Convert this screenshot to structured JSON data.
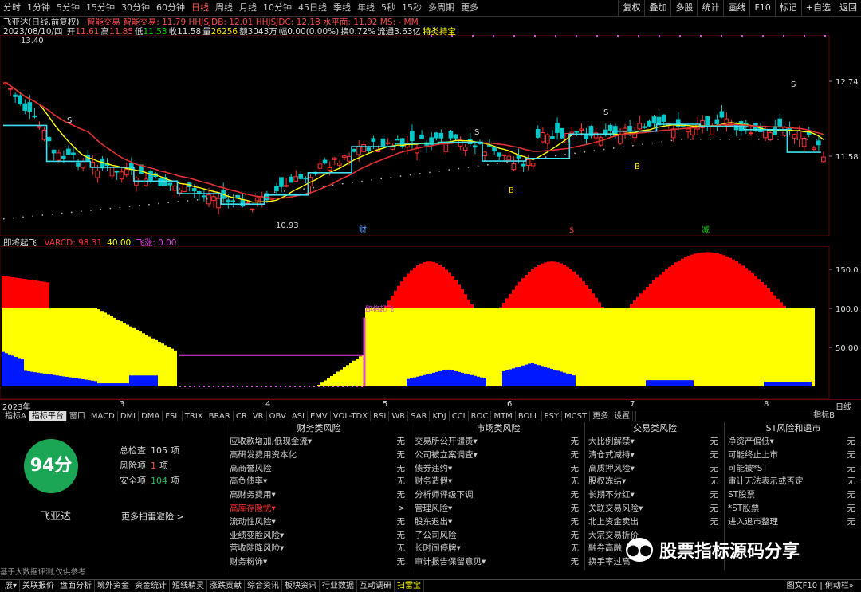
{
  "window": {
    "timeframes": [
      "分时",
      "1分钟",
      "5分钟",
      "15分钟",
      "30分钟",
      "60分钟",
      "日线",
      "周线",
      "月线",
      "10分钟",
      "45日线",
      "季线",
      "年线",
      "5秒",
      "15秒",
      "多周期",
      "更多"
    ],
    "active_timeframe": "日线",
    "right_buttons": [
      "复权",
      "叠加",
      "多股",
      "统计",
      "画线",
      "F10",
      "标记",
      "+自选",
      "返回"
    ]
  },
  "stock": {
    "title_line": "飞亚达(日线,前复权)",
    "indicator_text": "智能交易 智能交易: 11.79  HHJSJDB: 12.01  HHJSJDC: 12.18  水平面: 11.92  MS: - MM",
    "date_line": "2023/08/10/四",
    "ohlc": [
      {
        "label": "开",
        "value": "11.61",
        "color": "#ff4a4a"
      },
      {
        "label": "高",
        "value": "11.85",
        "color": "#ff4a4a"
      },
      {
        "label": "低",
        "value": "11.53",
        "color": "#00d000"
      },
      {
        "label": "收",
        "value": "11.58",
        "color": "#dddddd"
      },
      {
        "label": "量",
        "value": "26256",
        "color": "#ffdd00"
      },
      {
        "label": "额",
        "value": "3043万",
        "color": "#dddddd"
      },
      {
        "label": "幅",
        "value": "0.00(0.00%)",
        "color": "#dddddd"
      },
      {
        "label": "换",
        "value": "0.72%",
        "color": "#dddddd"
      },
      {
        "label": "流通",
        "value": "3.63亿",
        "color": "#dddddd"
      },
      {
        "label": "",
        "value": "特类持宝",
        "color": "#ffff00"
      }
    ],
    "price_high_label": "13.40",
    "price_low_label": "10.93",
    "price_axis": [
      "12.74",
      "11.58"
    ],
    "markers": [
      {
        "label": "S",
        "color": "#dddddd"
      },
      {
        "label": "S",
        "color": "#dddddd"
      },
      {
        "label": "S",
        "color": "#dddddd"
      },
      {
        "label": "S",
        "color": "#dddddd"
      },
      {
        "label": "B",
        "color": "#ffdd00"
      },
      {
        "label": "B",
        "color": "#ffdd00"
      },
      {
        "label": "财",
        "color": "#5aa0ff"
      },
      {
        "label": "减",
        "color": "#00d000"
      },
      {
        "label": "$",
        "color": "#ff4a4a"
      }
    ]
  },
  "subchart": {
    "name": "即将起飞",
    "legend": [
      {
        "label": "VARCD: 98.31",
        "color": "#ff3030"
      },
      {
        "label": "40.00",
        "color": "#ffff00"
      },
      {
        "label": "飞涨: 0.00",
        "color": "#e040e0"
      }
    ],
    "signal_label": "即将起飞",
    "axis": [
      "150.0",
      "100.0",
      "50.00"
    ]
  },
  "xaxis": {
    "labels": [
      "2023年",
      "3",
      "4",
      "5",
      "6",
      "7",
      "8"
    ],
    "right": "日线"
  },
  "tabs": [
    "指标A",
    "指标平台",
    "窗口",
    "MACD",
    "DMI",
    "DMA",
    "FSL",
    "TRIX",
    "BRAR",
    "CR",
    "VR",
    "OBV",
    "ASI",
    "EMV",
    "VOL-TDX",
    "RSI",
    "WR",
    "SAR",
    "KDJ",
    "CCI",
    "ROC",
    "MTM",
    "BOLL",
    "PSY",
    "MCST",
    "更多",
    "设置"
  ],
  "tabs_right": "指标B",
  "panel": {
    "score": "94分",
    "stock_name": "飞亚达",
    "more_link": "更多扫雷避险 >",
    "stats": [
      {
        "label": "总检查",
        "value": "105",
        "unit": "项",
        "color": "#dddddd"
      },
      {
        "label": "风险项",
        "value": "1",
        "unit": "项",
        "color": "#ff4a4a"
      },
      {
        "label": "安全项",
        "value": "104",
        "unit": "项",
        "color": "#1ec060"
      }
    ],
    "columns": [
      {
        "title": "财务类风险",
        "rows": [
          {
            "name": "应收款增加,低现金流▾",
            "value": "无"
          },
          {
            "name": "高研发费用资本化",
            "value": "无"
          },
          {
            "name": "高商誉风险",
            "value": "无"
          },
          {
            "name": "高负债率▾",
            "value": "无"
          },
          {
            "name": "高财务费用▾",
            "value": "无"
          },
          {
            "name": "高库存隐忧▾",
            "value": ">",
            "risk": true
          },
          {
            "name": "流动性风险▾",
            "value": "无"
          },
          {
            "name": "业绩变脸风险▾",
            "value": "无"
          },
          {
            "name": "营收陡降风险▾",
            "value": "无"
          },
          {
            "name": "财务粉饰▾",
            "value": "无"
          }
        ]
      },
      {
        "title": "市场类风险",
        "rows": [
          {
            "name": "交易所公开谴责▾",
            "value": "无"
          },
          {
            "name": "公司被立案调查▾",
            "value": "无"
          },
          {
            "name": "债券违约▾",
            "value": "无"
          },
          {
            "name": "财务造假▾",
            "value": "无"
          },
          {
            "name": "分析师评级下调",
            "value": "无"
          },
          {
            "name": "管理风险▾",
            "value": "无"
          },
          {
            "name": "股东退出▾",
            "value": "无"
          },
          {
            "name": "子公司风险",
            "value": "无"
          },
          {
            "name": "长时间停牌▾",
            "value": "无"
          },
          {
            "name": "审计报告保留意见▾",
            "value": "无"
          }
        ]
      },
      {
        "title": "交易类风险",
        "rows": [
          {
            "name": "大比例解禁▾",
            "value": "无"
          },
          {
            "name": "清仓式减持▾",
            "value": "无"
          },
          {
            "name": "高质押风险▾",
            "value": "无"
          },
          {
            "name": "股权冻结▾",
            "value": "无"
          },
          {
            "name": "长期不分红▾",
            "value": "无"
          },
          {
            "name": "关联交易风险▾",
            "value": "无"
          },
          {
            "name": "北上资金卖出",
            "value": "无"
          },
          {
            "name": "大宗交易折价",
            "value": ""
          },
          {
            "name": "融券高融",
            "value": ""
          },
          {
            "name": "换手率过高",
            "value": ""
          }
        ]
      },
      {
        "title": "ST风险和退市",
        "rows": [
          {
            "name": "净资产偏低▾",
            "value": "无"
          },
          {
            "name": "可能终止上市",
            "value": "无"
          },
          {
            "name": "可能被*ST",
            "value": "无"
          },
          {
            "name": "审计无法表示或否定",
            "value": "无"
          },
          {
            "name": "ST股票",
            "value": "无"
          },
          {
            "name": "*ST股票",
            "value": "无"
          },
          {
            "name": "进入退市整理",
            "value": "无"
          }
        ]
      }
    ],
    "footnote": "基于大数据评测,仅供参考"
  },
  "bottom_tabs": [
    "展▾",
    "关联报价",
    "盘面分析",
    "境外资金",
    "资金统计",
    "短线精灵",
    "涨跌贡献",
    "综合资讯",
    "板块资讯",
    "行业数据",
    "互动调研",
    "扫雷宝"
  ],
  "bottom_right": "图文F10  |  俐动栏»",
  "watermark": "股票指标源码分享",
  "colors": {
    "up": "#ff3030",
    "down": "#00c8c8",
    "ma_yellow": "#ffff00",
    "ma_red": "#e03030",
    "line_cyan": "#40e0f0",
    "fill_red": "#ff0000",
    "fill_yellow": "#ffff00",
    "fill_blue": "#0018ff"
  }
}
